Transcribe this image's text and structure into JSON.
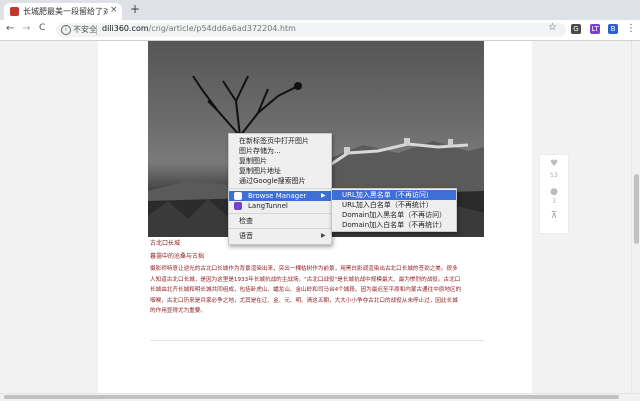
{
  "browser": {
    "tab_title": "长城肥最美一段留给了对比 | 中国",
    "tab_close": "×",
    "new_tab": "+",
    "nav_back": "←",
    "nav_forward": "→",
    "nav_reload": "C",
    "security_label": "不安全",
    "url_host": "dili360.com",
    "url_path": "/cng/article/p54dd6a6ad372204.htm",
    "star": "☆",
    "menu": "⋮",
    "extensions": [
      {
        "name": "translate-extension-icon",
        "label": "G",
        "color": "#4a4a4a"
      },
      {
        "name": "langtunnel-extension-icon",
        "label": "LT",
        "color": "#7b3fd0"
      },
      {
        "name": "browse-manager-extension-icon",
        "label": "B",
        "color": "#2f5fc8"
      }
    ]
  },
  "article": {
    "caption": "古北口长城",
    "subhead": "暮霭中的沧桑与古拙",
    "body_lines": [
      "摄影师特意让逆光的古北口长城作为背景渲染出来，突出一棵枯树作为前景，用黑白影调渲染出古北口长城的苍劲之美。很多",
      "人知道古北口长城，是因为这里是1933年长城抗战的主战场。\"古北口战役\"是长城抗战中规模最大、最为惨烈的战役。古北口",
      "长城由北齐长城和明长城共同组成，包括卧虎山、蟠龙山、金山岭和司马台4个城段。因为最迟至平原和内蒙古通往中原地区的",
      "咽喉，古北口历来是兵家必争之地，尤其是在辽、金、元、明、清这五朝，大大小小争夺古北口的战役从未停止过，因此长城",
      "的作用显得尤为重要。"
    ]
  },
  "side_widget": {
    "like_icon": "♥",
    "like_count": "53",
    "comment_icon": "●",
    "comment_count": "3",
    "top_icon": "⊼"
  },
  "context_menu": {
    "items": [
      {
        "label": "在新标签页中打开图片"
      },
      {
        "label": "图片存储为..."
      },
      {
        "label": "复制图片"
      },
      {
        "label": "复制图片地址"
      },
      {
        "label": "通过Google搜索图片"
      },
      {
        "label": "Browse Manager",
        "submenu": true
      },
      {
        "label": "LangTunnel"
      },
      {
        "label": "检查"
      },
      {
        "label": "语音",
        "submenu": true
      }
    ],
    "submenu_arrow": "▶"
  },
  "submenu": {
    "items": [
      {
        "label": "URL加入黑名单（不再访问）"
      },
      {
        "label": "URL加入白名单（不再统计）"
      },
      {
        "label": "Domain加入黑名单（不再访问）"
      },
      {
        "label": "Domain加入白名单（不再统计）"
      }
    ]
  },
  "colors": {
    "accent": "#3d6fd6",
    "article_text": "#8b1a1a"
  }
}
